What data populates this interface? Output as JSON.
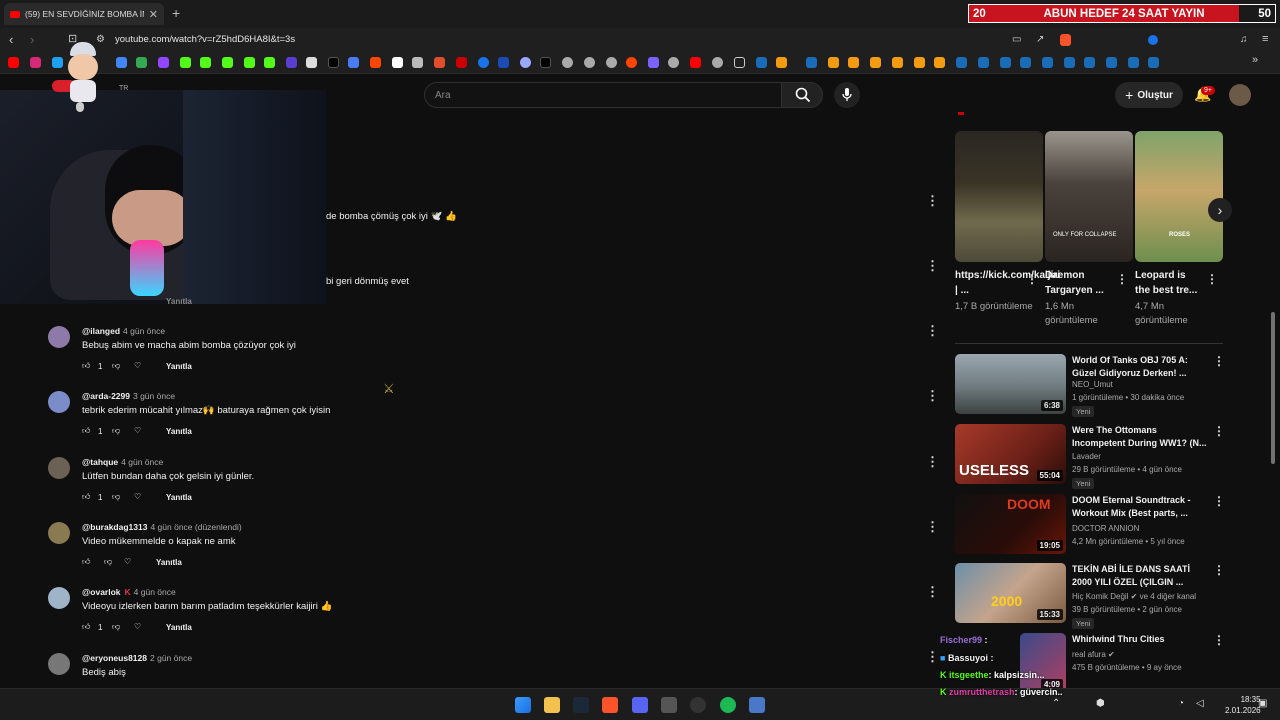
{
  "browser": {
    "tab_title": "(59) EN SEVDİĞİNİZ BOMBA İMH",
    "new_tab": "+",
    "url": "youtube.com/watch?v=rZ5hdD6HA8I&t=3s"
  },
  "overlay": {
    "goal_left": "20",
    "goal_text": "ABUN HEDEF 24 SAAT YAYIN",
    "goal_right": "50"
  },
  "header": {
    "country": "TR",
    "search_placeholder": "Ara",
    "create_label": "Oluştur",
    "notif_count": "9+"
  },
  "partial_comments": [
    {
      "text": "de bomba çömüş çok iyi 🕊️ 👍"
    },
    {
      "text": "bi geri dönmüş evet"
    }
  ],
  "partial_reply": "Yanıtla",
  "comments": [
    {
      "user": "@ilanged",
      "date": "4 gün önce",
      "text": "Bebuş abim ve macha abim bomba çözüyor çok iyi",
      "likes": "1",
      "reply": "Yanıtla",
      "kick": ""
    },
    {
      "user": "@arda-2299",
      "date": "3 gün önce",
      "text": "tebrik ederim mücahit yılmaz🙌 baturaya rağmen çok iyisin",
      "likes": "1",
      "reply": "Yanıtla",
      "kick": ""
    },
    {
      "user": "@tahque",
      "date": "4 gün önce",
      "text": "Lütfen bundan daha çok gelsin iyi günler.",
      "likes": "1",
      "reply": "Yanıtla",
      "kick": ""
    },
    {
      "user": "@burakdag1313",
      "date": "4 gün önce (düzenlendi)",
      "text": "Video mükemmelde o kapak ne amk",
      "likes": "",
      "reply": "Yanıtla",
      "kick": ""
    },
    {
      "user": "@ovarlok",
      "date": "4 gün önce",
      "text": "Videoyu izlerken barım barım patladım teşekkürler kaijiri 👍",
      "likes": "1",
      "reply": "Yanıtla",
      "kick": "K"
    },
    {
      "user": "@eryoneus8128",
      "date": "2 gün önce",
      "text": "Bediş abiş",
      "likes": "",
      "reply": "",
      "kick": ""
    }
  ],
  "shorts": [
    {
      "title": "https://kick.com/kaijiri | ...",
      "views": "1,7 B görüntüleme"
    },
    {
      "title": "Daemon Targaryen ...",
      "views": "1,6 Mn görüntüleme"
    },
    {
      "title": "Leopard is the best tre...",
      "views": "4,7 Mn görüntüleme"
    }
  ],
  "shorts_overlay": [
    "ONLY FOR COLLAPSE",
    "ROSES"
  ],
  "videos": [
    {
      "title": "World Of Tanks OBJ 705 A: Güzel Gidiyoruz Derken! ...",
      "channel": "NEO_Umut",
      "meta": "1 görüntüleme • 30 dakika önce",
      "new": "Yeni",
      "duration": "6:38",
      "thumb_text": ""
    },
    {
      "title": "Were The Ottomans Incompetent During WW1? (N...",
      "channel": "Lavader",
      "meta": "29 B görüntüleme • 4 gün önce",
      "new": "Yeni",
      "duration": "55:04",
      "thumb_text": "USELESS"
    },
    {
      "title": "DOOM Eternal Soundtrack - Workout Mix (Best parts, ...",
      "channel": "DOCTOR ANNION",
      "meta": "4,2 Mn görüntüleme • 5 yıl önce",
      "new": "",
      "duration": "19:05",
      "thumb_text": "DOOM"
    },
    {
      "title": "TEKİN ABİ İLE DANS SAATİ 2000 YILI ÖZEL (ÇILGIN ...",
      "channel": "Hiç Komik Değil ✔ ve 4 diğer kanal",
      "meta": "39 B görüntüleme • 2 gün önce",
      "new": "Yeni",
      "duration": "15:33",
      "thumb_text": "2000"
    },
    {
      "title": "Whirlwind Thru Cities",
      "channel": "real afura ✔",
      "meta": "475 B görüntüleme • 9 ay önce",
      "new": "",
      "duration": "4:09",
      "thumb_text": ""
    }
  ],
  "chat": [
    {
      "user": "Fischer99",
      "text": ":"
    },
    {
      "user": "Bassuyoi",
      "text": ":"
    },
    {
      "user": "itsgeethe",
      "text": ": kalpsizsin..."
    },
    {
      "user": "zumrutthetrash",
      "text": ": güvercin.."
    }
  ],
  "taskbar": {
    "time": "18:35",
    "date": "2.01.2026"
  },
  "colors": {
    "bg": "#0f0f0f",
    "accent": "#ff0000",
    "goal": "#c8141e",
    "kick": "#53fc18"
  }
}
